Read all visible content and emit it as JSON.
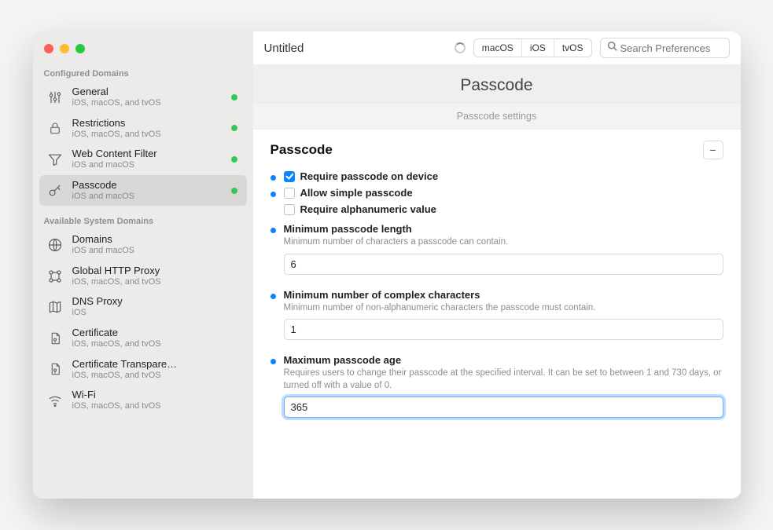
{
  "doc_title": "Untitled",
  "platforms": [
    "macOS",
    "iOS",
    "tvOS"
  ],
  "search_placeholder": "Search Preferences",
  "header": "Passcode",
  "subheader": "Passcode settings",
  "sidebar": {
    "configured_label": "Configured Domains",
    "available_label": "Available System Domains",
    "configured": [
      {
        "title": "General",
        "subtitle": "iOS, macOS, and tvOS",
        "icon": "sliders",
        "dot": true
      },
      {
        "title": "Restrictions",
        "subtitle": "iOS, macOS, and tvOS",
        "icon": "lock",
        "dot": true
      },
      {
        "title": "Web Content Filter",
        "subtitle": "iOS and macOS",
        "icon": "funnel",
        "dot": true
      },
      {
        "title": "Passcode",
        "subtitle": "iOS and macOS",
        "icon": "key",
        "dot": true,
        "selected": true
      }
    ],
    "available": [
      {
        "title": "Domains",
        "subtitle": "iOS and macOS",
        "icon": "globe"
      },
      {
        "title": "Global HTTP Proxy",
        "subtitle": "iOS, macOS, and tvOS",
        "icon": "proxy"
      },
      {
        "title": "DNS Proxy",
        "subtitle": "iOS",
        "icon": "map"
      },
      {
        "title": "Certificate",
        "subtitle": "iOS, macOS, and tvOS",
        "icon": "cert"
      },
      {
        "title": "Certificate Transpare…",
        "subtitle": "iOS, macOS, and tvOS",
        "icon": "cert"
      },
      {
        "title": "Wi-Fi",
        "subtitle": "iOS, macOS, and tvOS",
        "icon": "wifi"
      }
    ]
  },
  "section_title": "Passcode",
  "fields": {
    "require_label": "Require passcode on device",
    "allow_simple_label": "Allow simple passcode",
    "require_alpha_label": "Require alphanumeric value",
    "min_len_label": "Minimum passcode length",
    "min_len_desc": "Minimum number of characters a passcode can contain.",
    "min_len_value": "6",
    "min_complex_label": "Minimum number of complex characters",
    "min_complex_desc": "Minimum number of non-alphanumeric characters the passcode must contain.",
    "min_complex_value": "1",
    "max_age_label": "Maximum passcode age",
    "max_age_desc": "Requires users to change their passcode at the specified interval. It can be set to between 1 and 730 days, or turned off with a value of 0.",
    "max_age_value": "365"
  }
}
